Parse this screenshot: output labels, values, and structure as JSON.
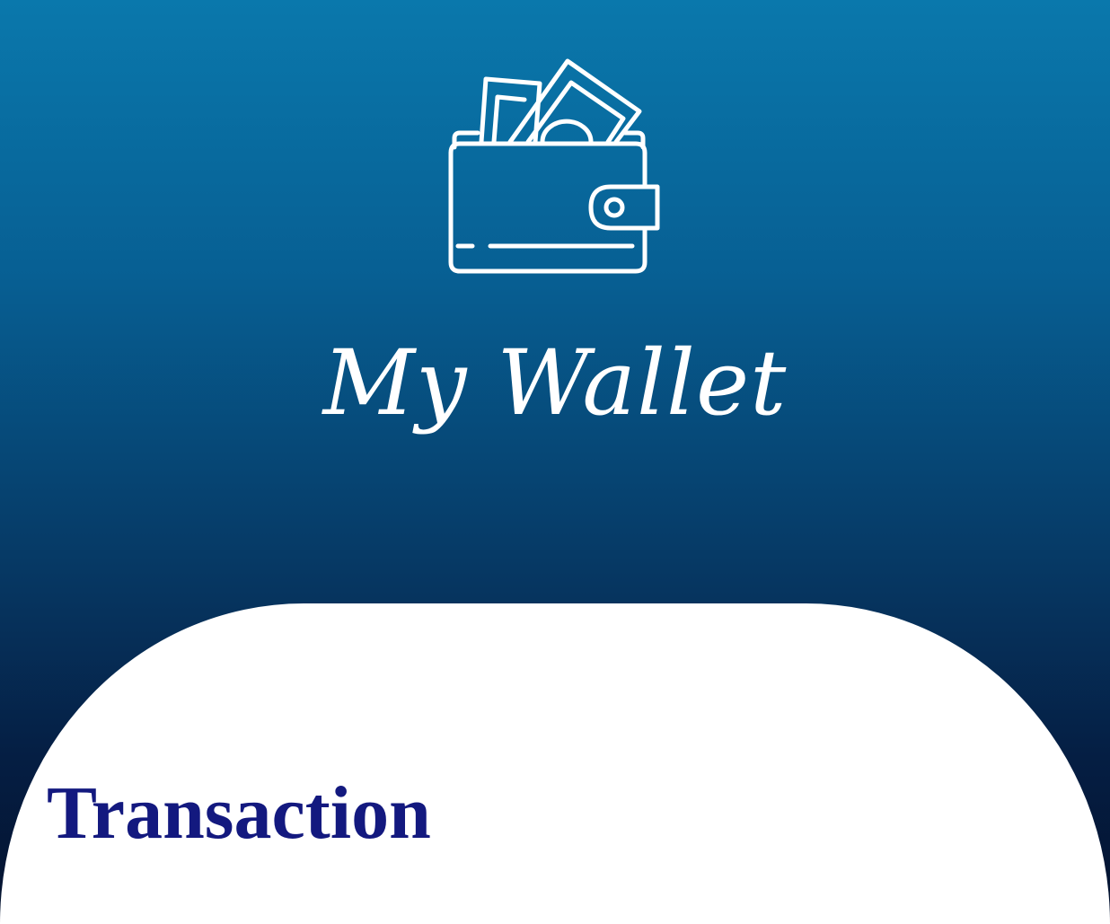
{
  "header": {
    "icon": "wallet-icon",
    "title": "My Wallet"
  },
  "main": {
    "section_title": "Transaction"
  },
  "colors": {
    "gradient_top": "#0a78ac",
    "gradient_bottom": "#04122e",
    "icon_stroke": "#ffffff",
    "sheet_background": "#ffffff",
    "section_title": "#13197f"
  }
}
